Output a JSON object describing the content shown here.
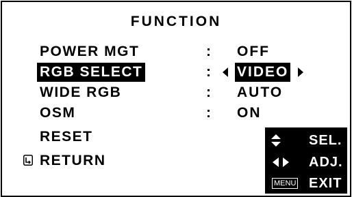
{
  "menu": {
    "title": "FUNCTION",
    "items": [
      {
        "label": "POWER MGT",
        "value": "OFF"
      },
      {
        "label": "RGB SELECT",
        "value": "VIDEO"
      },
      {
        "label": "WIDE RGB",
        "value": "AUTO"
      },
      {
        "label": "OSM",
        "value": "ON"
      },
      {
        "label": "RESET"
      },
      {
        "label": "RETURN"
      }
    ],
    "separator": ":",
    "selected_index": 1
  },
  "help": {
    "select_label": "SEL.",
    "adjust_label": "ADJ.",
    "menu_key": "MENU",
    "exit_label": "EXIT"
  },
  "icons": [
    "arrow-left-icon",
    "arrow-right-icon",
    "return-icon",
    "up-down-icon",
    "left-right-icon"
  ]
}
